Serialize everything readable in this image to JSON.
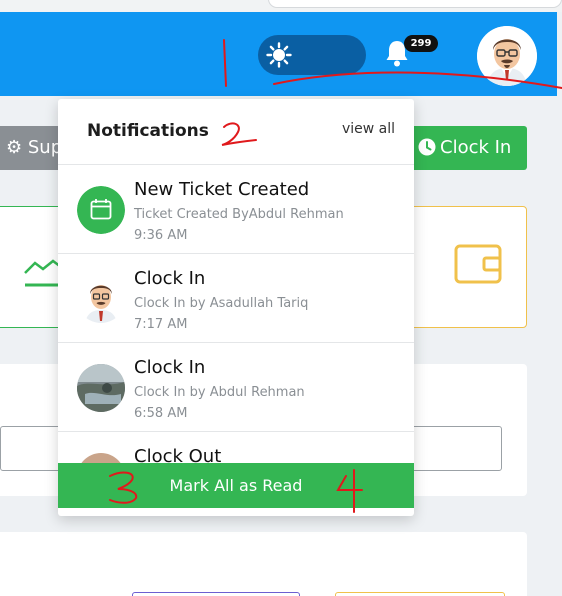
{
  "header": {
    "notification_count": "299",
    "colors": {
      "bar": "#0f96f2",
      "toggle": "#0a5fa3"
    }
  },
  "page": {
    "support_label": "Supp",
    "clock_in_label": "Clock In"
  },
  "notifications_panel": {
    "title": "Notifications",
    "view_all": "view all",
    "items": [
      {
        "title": "New Ticket Created",
        "subtitle": "Ticket Created ByAbdul Rehman",
        "time": "9:36 AM",
        "icon": "calendar-icon"
      },
      {
        "title": "Clock In",
        "subtitle": "Clock In by Asadullah Tariq",
        "time": "7:17 AM",
        "icon": "avatar-icon"
      },
      {
        "title": "Clock In",
        "subtitle": "Clock In by Abdul Rehman",
        "time": "6:58 AM",
        "icon": "avatar-photo-icon"
      },
      {
        "title": "Clock Out",
        "subtitle": "",
        "time": "",
        "icon": "avatar-photo-icon"
      }
    ],
    "mark_all_label": "Mark All as Read",
    "accent": "#34b653"
  },
  "annotations": {
    "color": "#e0191c",
    "labels": [
      "1",
      "2",
      "3",
      "4"
    ]
  }
}
